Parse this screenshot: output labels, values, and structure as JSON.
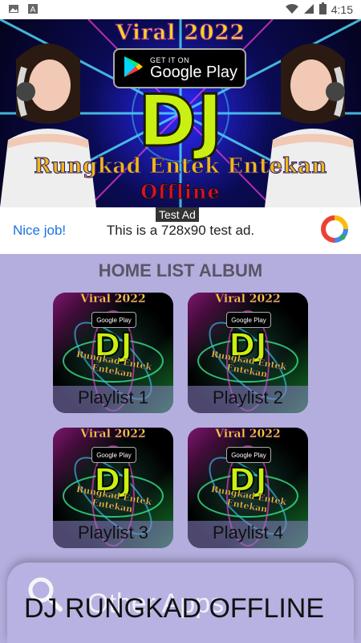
{
  "status_bar": {
    "time": "4:15",
    "icons": [
      "image-icon",
      "notification-a-icon",
      "wifi-icon",
      "signal-icon",
      "battery-icon"
    ]
  },
  "banner": {
    "viral_text": "Viral 2022",
    "store_badge_small": "GET IT ON",
    "store_badge_big": "Google Play",
    "dj_text": "DJ",
    "subtitle": "Rungkad Entek Entekan",
    "offline_text": "Offline"
  },
  "ad": {
    "label": "Test Ad",
    "nice_job": "Nice job!",
    "text": "This is a 728x90 test ad."
  },
  "home": {
    "title": "HOME LIST ALBUM",
    "playlists": [
      {
        "label": "Playlist 1"
      },
      {
        "label": "Playlist 2"
      },
      {
        "label": "Playlist 3"
      },
      {
        "label": "Playlist 4"
      }
    ],
    "card_viral": "Viral 2022",
    "card_gp": "Google Play",
    "card_dj": "DJ",
    "card_subtitle": "Rungkad Entek Entekan"
  },
  "bottom_sheet": {
    "other_apps_label": "Other Apps",
    "app_title": "DJ RUNGKAD OFFLINE"
  },
  "colors": {
    "background": "#b4aede",
    "dj_green": "#c9f012",
    "link_blue": "#1a73e8"
  }
}
